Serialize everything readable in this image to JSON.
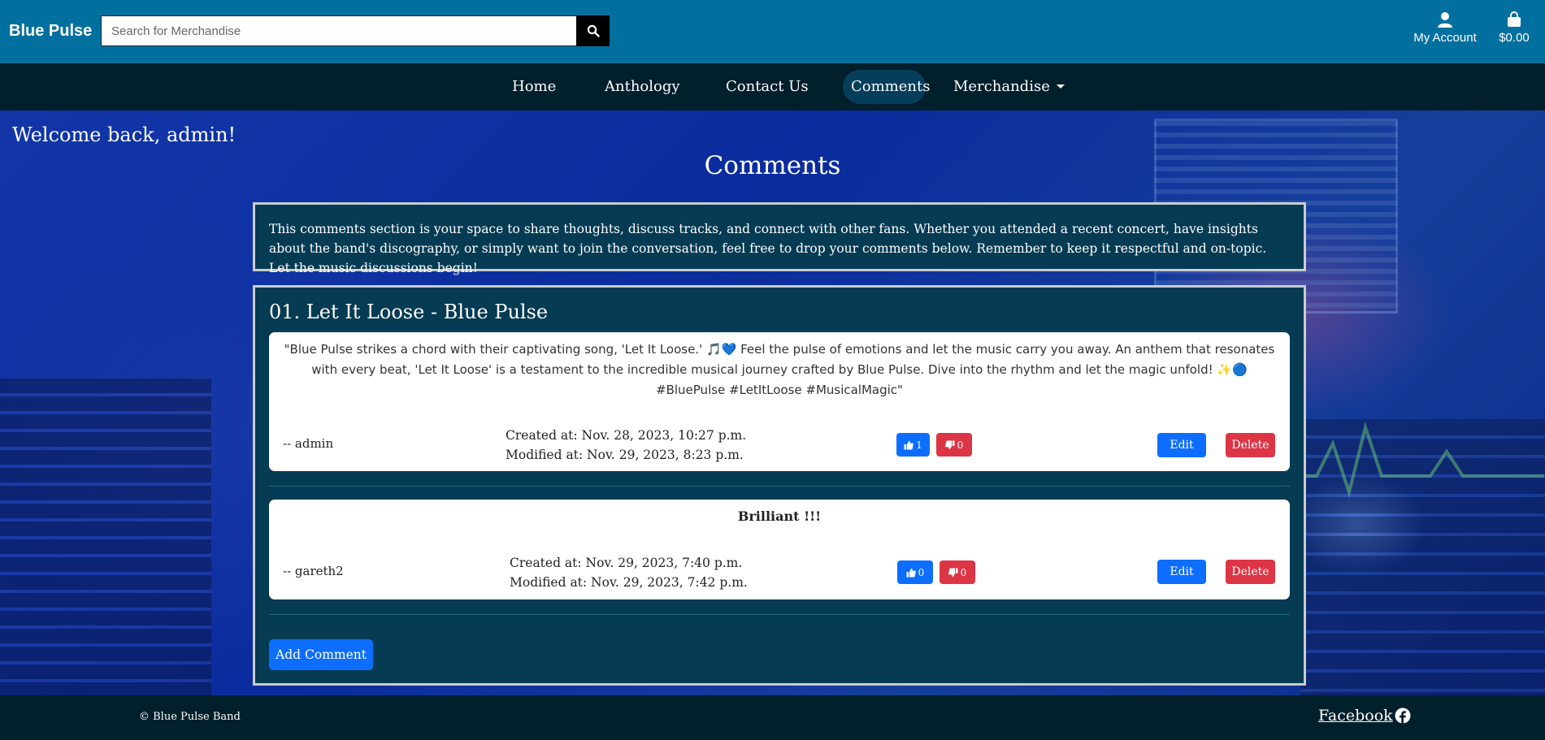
{
  "header": {
    "brand": "Blue Pulse",
    "search_placeholder": "Search for Merchandise",
    "account_label": "My Account",
    "cart_total": "$0.00"
  },
  "nav": {
    "items": [
      {
        "label": "Home"
      },
      {
        "label": "Anthology"
      },
      {
        "label": "Contact Us"
      },
      {
        "label": "Comments"
      },
      {
        "label": "Merchandise"
      }
    ],
    "active": "Comments"
  },
  "main": {
    "welcome": "Welcome back, admin!",
    "title": "Comments",
    "intro": "This comments section is your space to share thoughts, discuss tracks, and connect with other fans. Whether you attended a recent concert, have insights about the band's discography, or simply want to join the conversation, feel free to drop your comments below. Remember to keep it respectful and on-topic. Let the music discussions begin!",
    "song_title": "01. Let It Loose - Blue Pulse",
    "comments": [
      {
        "text": "\"Blue Pulse strikes a chord with their captivating song, 'Let It Loose.' 🎵💙 Feel the pulse of emotions and let the music carry you away. An anthem that resonates with every beat, 'Let It Loose' is a testament to the incredible musical journey crafted by Blue Pulse. Dive into the rhythm and let the magic unfold! ✨🔵 #BluePulse #LetItLoose #MusicalMagic\"",
        "author": "-- admin",
        "created": "Created at: Nov. 28, 2023, 10:27 p.m.",
        "modified": "Modified at: Nov. 29, 2023, 8:23 p.m.",
        "likes": "1",
        "dislikes": "0",
        "edit_label": "Edit",
        "delete_label": "Delete"
      },
      {
        "text": "Brilliant !!!",
        "author": "-- gareth2",
        "created": "Created at: Nov. 29, 2023, 7:40 p.m.",
        "modified": "Modified at: Nov. 29, 2023, 7:42 p.m.",
        "likes": "0",
        "dislikes": "0",
        "edit_label": "Edit",
        "delete_label": "Delete"
      }
    ],
    "add_comment_label": "Add Comment"
  },
  "footer": {
    "copyright": "© Blue Pulse Band",
    "facebook_label": "Facebook"
  },
  "colors": {
    "topbar": "#02709e",
    "nav": "#021f2c",
    "panel": "#053b53",
    "primary": "#0d6efd",
    "danger": "#dc3545"
  }
}
